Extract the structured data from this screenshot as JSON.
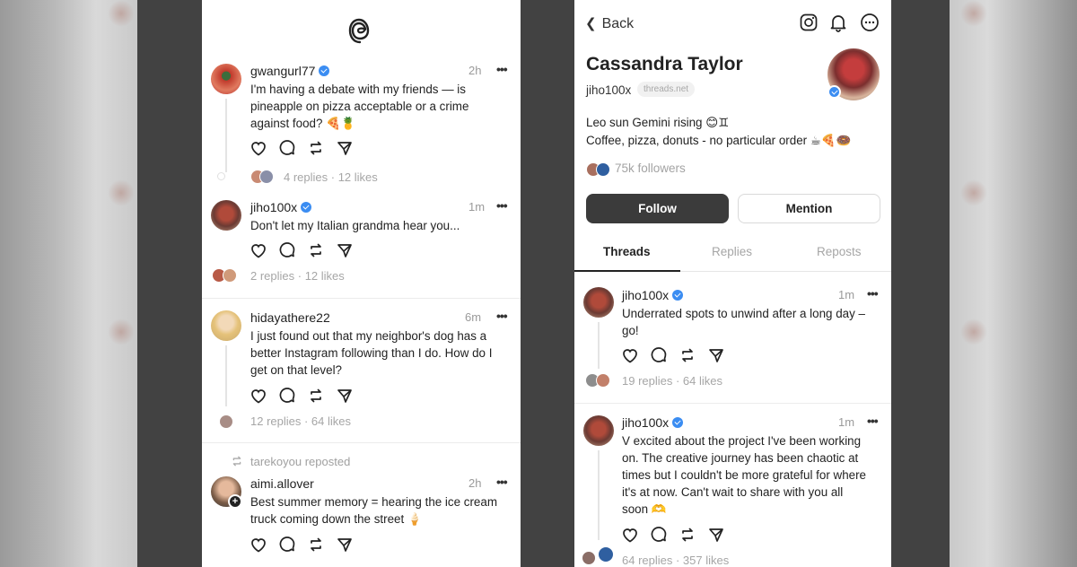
{
  "left_feed": {
    "posts": [
      {
        "username": "gwangurl77",
        "verified": true,
        "time": "2h",
        "text_lines": [
          "I'm having a debate with my friends — is",
          "pineapple on pizza acceptable or a crime",
          "against food? 🍕🍍"
        ],
        "stats": "4 replies · 12 likes"
      },
      {
        "username": "jiho100x",
        "verified": true,
        "time": "1m",
        "text_lines": [
          "Don't let my Italian grandma hear you..."
        ],
        "stats": "2 replies · 12 likes"
      },
      {
        "username": "hidayathere22",
        "verified": false,
        "time": "6m",
        "text_lines": [
          "I just found out that my neighbor's dog has a",
          "better Instagram following than I do. How do I",
          "get on that level?"
        ],
        "stats": "12 replies · 64 likes"
      },
      {
        "repost_note": "tarekoyou reposted",
        "username": "aimi.allover",
        "verified": false,
        "time": "2h",
        "text_lines": [
          "Best summer memory = hearing the ice cream",
          "truck coming down the street 🍦"
        ]
      }
    ]
  },
  "profile": {
    "back_label": "Back",
    "name": "Cassandra Taylor",
    "handle": "jiho100x",
    "domain_chip": "threads.net",
    "bio_lines": [
      "Leo sun Gemini rising 😊♊",
      "Coffee, pizza, donuts - no particular order ☕🍕🍩"
    ],
    "followers": "75k followers",
    "follow_label": "Follow",
    "mention_label": "Mention",
    "tabs": [
      "Threads",
      "Replies",
      "Reposts"
    ],
    "posts": [
      {
        "username": "jiho100x",
        "time": "1m",
        "text_lines": [
          "Underrated spots to unwind after a long day –",
          "go!"
        ],
        "stats": "19 replies · 64 likes"
      },
      {
        "username": "jiho100x",
        "time": "1m",
        "text_lines": [
          "V excited about the project I've been working",
          "on. The creative journey has been chaotic at",
          "times but I couldn't be more grateful for where",
          "it's at now. Can't wait to share with you all",
          "soon 🫶"
        ],
        "stats": "64 replies · 357 likes"
      }
    ]
  },
  "icons": {
    "more": "more-icon",
    "like": "heart-icon",
    "reply": "comment-icon",
    "repost": "repost-icon",
    "share": "share-icon",
    "logo": "threads-logo-icon",
    "instagram": "instagram-icon",
    "notifications": "bell-icon",
    "options": "ellipsis-circle-icon"
  },
  "colors": {
    "verified": "#3b8df2",
    "follow_button": "#3b3b3b",
    "muted_text": "#a6a6a6"
  }
}
